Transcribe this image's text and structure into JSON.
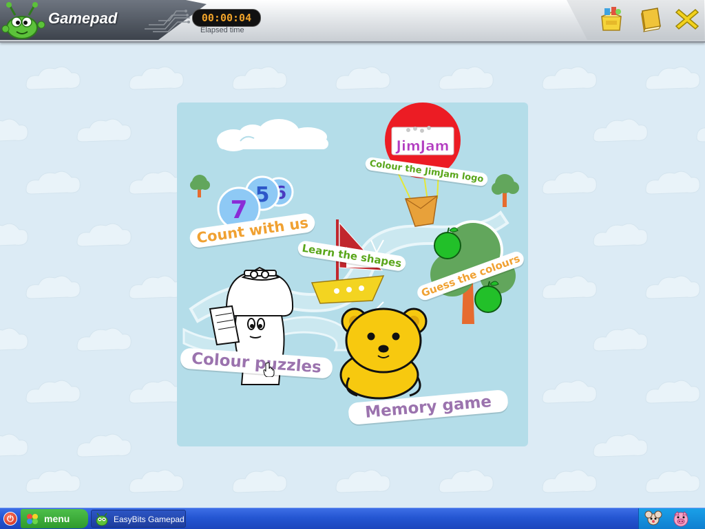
{
  "app": {
    "title": "Gamepad",
    "timer": "00:00:04",
    "timer_caption": "Elapsed time"
  },
  "toolbar": {
    "icons": [
      "games-box-icon",
      "book-icon",
      "close-x-icon"
    ]
  },
  "board": {
    "badge_text": "JimJam",
    "count_numbers": [
      "7",
      "5",
      "6"
    ],
    "activities": {
      "count": "Count with us",
      "jimjam": "Colour the JimJam logo",
      "shapes": "Learn the shapes",
      "colours": "Guess the colours",
      "puzzles": "Colour puzzles",
      "memory": "Memory game"
    }
  },
  "taskbar": {
    "menu_label": "menu",
    "task_label": "EasyBits Gamepad",
    "tray_icons": [
      "mouse-character-icon",
      "pig-character-icon"
    ]
  },
  "colors": {
    "background": "#dcebf5",
    "board": "#b4dde9",
    "orange_label": "#f0a132",
    "green_label": "#5aa61b",
    "purple_label": "#9b73ae",
    "taskbar_blue": "#2456d2"
  }
}
